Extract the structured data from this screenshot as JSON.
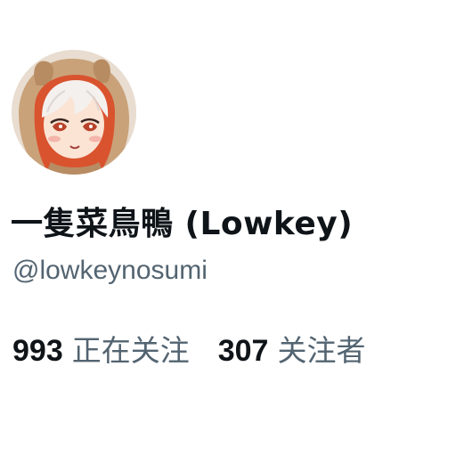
{
  "profile": {
    "avatar_icon": "anime-character-avatar",
    "display_name": "一隻菜鳥鴨 (Lowkey)",
    "handle": "@lowkeynosumi"
  },
  "stats": {
    "following_count": "993",
    "following_label": "正在关注",
    "followers_count": "307",
    "followers_label": "关注者"
  },
  "colors": {
    "primary_text": "#0f1419",
    "secondary_text": "#536471",
    "background": "#ffffff"
  }
}
